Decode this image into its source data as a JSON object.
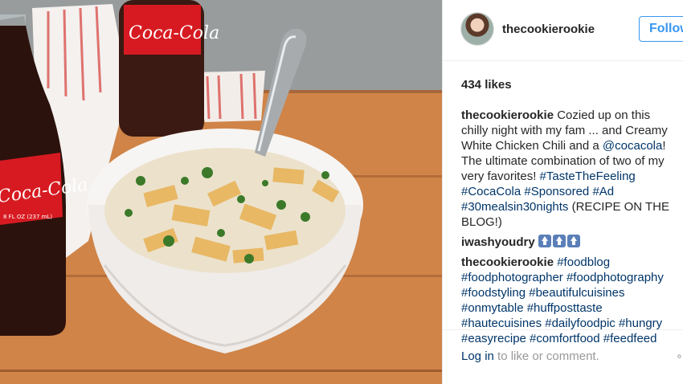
{
  "post": {
    "username": "thecookierookie",
    "follow_label": "Follow",
    "likes_text": "434 likes"
  },
  "comments": {
    "caption": {
      "user": "thecookierookie",
      "text": " Cozied up on this chilly night with my fam ... and Creamy White Chicken Chili and a ",
      "mention": "@cocacola",
      "text2": "! The ultimate combination of two of my very favorites! ",
      "tags": "#TasteTheFeeling #CocaCola #Sponsored #Ad #30mealsin30nights",
      "text3": " (RECIPE ON THE BLOG!)"
    },
    "reply": {
      "user": "iwashyoudry",
      "emoji_name": "up-arrow-emoji"
    },
    "hashtags_comment": {
      "user": "thecookierookie",
      "tags": " #foodblog #foodphotographer #foodphotography #foodstyling #beautifulcuisines #onmytable #huffposttaste #hautecuisines #dailyfoodpic #hungry #easyrecipe #comfortfood #feedfeed"
    }
  },
  "footer": {
    "login_link": "Log in",
    "login_rest": " to like or comment.",
    "more": "∘"
  },
  "photo": {
    "bottle_brand": "Coca-Cola",
    "bottle_label_small": "8 FL OZ (237 mL)"
  },
  "colors": {
    "link": "#003569",
    "follow_blue": "#3897f0",
    "coke_red": "#d71a21"
  }
}
